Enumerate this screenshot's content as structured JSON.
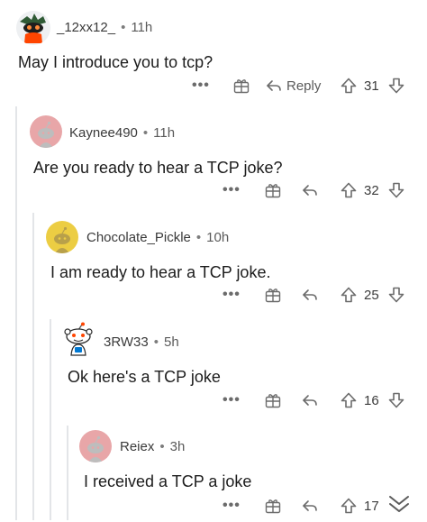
{
  "comments": [
    {
      "username": "_12xx12_",
      "time": "11h",
      "text": "May I introduce you to tcp?",
      "votes": "31",
      "reply_label": "Reply"
    },
    {
      "username": "Kaynee490",
      "time": "11h",
      "text": "Are you ready to hear a TCP joke?",
      "votes": "32"
    },
    {
      "username": "Chocolate_Pickle",
      "time": "10h",
      "text": "I am ready to hear a TCP joke.",
      "votes": "25"
    },
    {
      "username": "3RW33",
      "time": "5h",
      "text": "Ok here's a TCP joke",
      "votes": "16"
    },
    {
      "username": "Reiex",
      "time": "3h",
      "text": "I received a TCP a joke",
      "votes": "17"
    }
  ],
  "meta_separator": "•",
  "more_glyph": "•••",
  "icons": {
    "more": "more-options-icon",
    "award": "award-gift-icon",
    "reply": "reply-arrow-icon",
    "upvote": "upvote-arrow-icon",
    "downvote": "downvote-arrow-icon",
    "scroll": "double-chevron-down-icon"
  },
  "colors": {
    "thread_line": "#e3e5e8",
    "avatar_pink": "#e8a6a8",
    "avatar_yellow": "#eccd43",
    "avatar_orange": "#ff4500",
    "icon_gray": "#6b6b6b"
  }
}
